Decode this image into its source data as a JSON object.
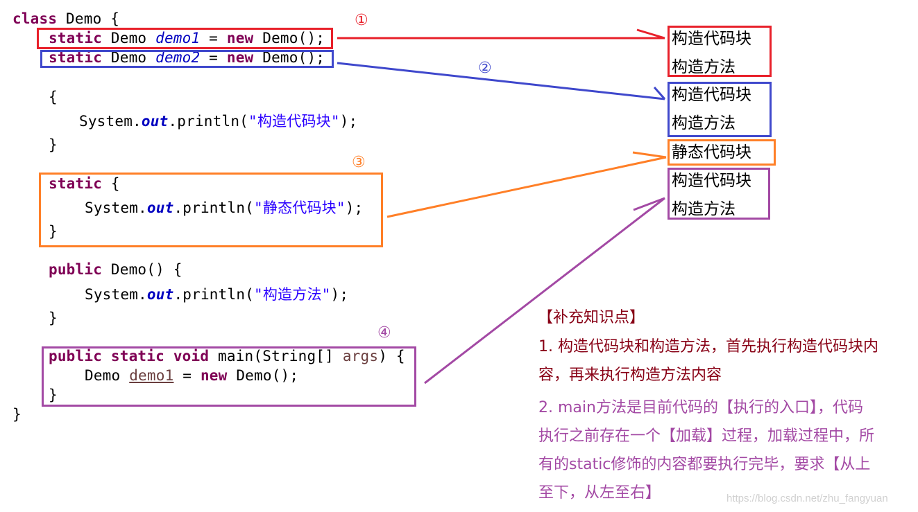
{
  "code": {
    "l1": {
      "kw": "class",
      "rest": " Demo {"
    },
    "l2": {
      "kw1": "static",
      "t1": " Demo ",
      "field": "demo1",
      "t2": " = ",
      "kw2": "new",
      "t3": " Demo();"
    },
    "l3": {
      "kw1": "static",
      "t1": " Demo ",
      "field": "demo2",
      "t2": " = ",
      "kw2": "new",
      "t3": " Demo();"
    },
    "l4": "{",
    "l5": {
      "t1": "System.",
      "out": "out",
      "t2": ".println(",
      "str": "\"构造代码块\"",
      "t3": ");"
    },
    "l6": "}",
    "l7": {
      "kw": "static",
      "rest": " {"
    },
    "l8": {
      "t1": "System.",
      "out": "out",
      "t2": ".println(",
      "str": "\"静态代码块\"",
      "t3": ");"
    },
    "l9": "}",
    "l10": {
      "kw": "public",
      "rest": " Demo() {"
    },
    "l11": {
      "t1": "System.",
      "out": "out",
      "t2": ".println(",
      "str": "\"构造方法\"",
      "t3": ");"
    },
    "l12": "}",
    "l13": {
      "kw1": "public",
      "kw2": "static",
      "kw3": "void",
      "t1": " main(String[] ",
      "param": "args",
      "t2": ") {"
    },
    "l14": {
      "t1": "Demo ",
      "local": "demo1",
      "t2": " = ",
      "kw": "new",
      "t3": " Demo();"
    },
    "l15": "}",
    "l16": "}"
  },
  "markers": {
    "m1": "①",
    "m2": "②",
    "m3": "③",
    "m4": "④"
  },
  "output": {
    "group1": [
      "构造代码块",
      "构造方法"
    ],
    "group2": [
      "构造代码块",
      "构造方法"
    ],
    "group3": [
      "静态代码块"
    ],
    "group4": [
      "构造代码块",
      "构造方法"
    ]
  },
  "colors": {
    "step1": "#e8202a",
    "step2": "#3f48cc",
    "step3": "#ff7f27",
    "step4": "#a349a4",
    "note1": "#880015",
    "note2": "#a349a4"
  },
  "notes": {
    "title": "【补充知识点】",
    "p1": [
      "1. 构造代码块和构造方法，首先执行构造代码块内",
      "容，再来执行构造方法内容"
    ],
    "p2": [
      "2. main方法是目前代码的【执行的入口】，代码",
      "执行之前存在一个【加载】过程，加载过程中，所",
      "有的static修饰的内容都要执行完毕，要求【从上",
      "至下，从左至右】"
    ]
  },
  "watermark": "https://blog.csdn.net/zhu_fangyuan"
}
